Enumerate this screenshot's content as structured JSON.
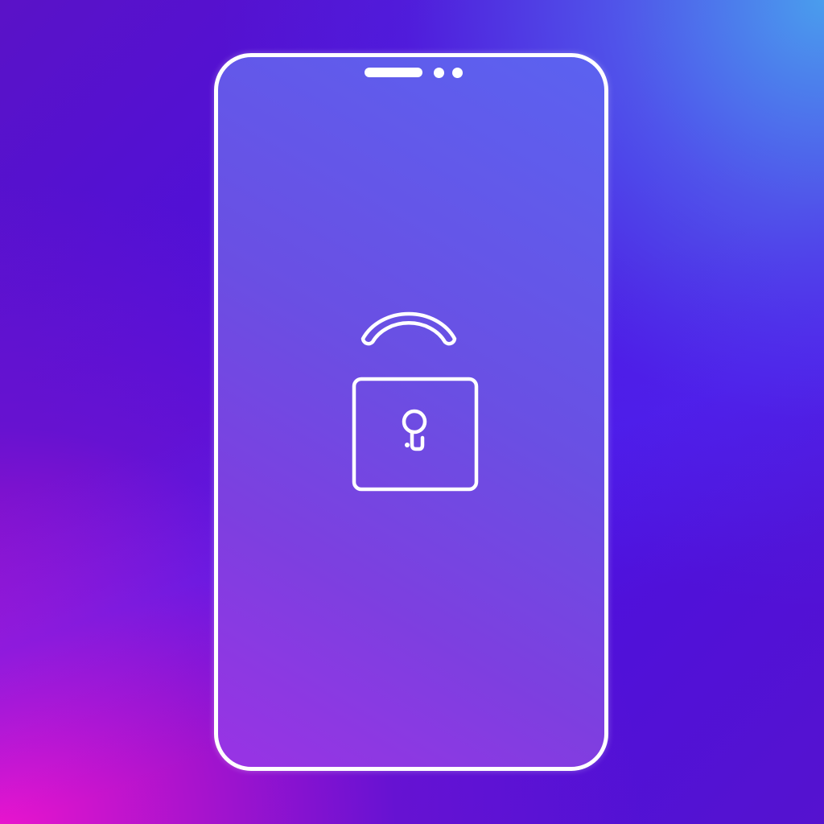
{
  "scene": {
    "subject": "unlocked-phone",
    "background_colors": [
      "#4a0fe2",
      "#4aa5ee",
      "#ea14cd"
    ],
    "phone_screen_colors": [
      "#5b62f0",
      "#9933e4"
    ],
    "outline_color": "#ffffff",
    "icons": [
      "phone-outline",
      "speaker-grille",
      "front-sensor",
      "unlocked-padlock",
      "keyhole"
    ]
  }
}
